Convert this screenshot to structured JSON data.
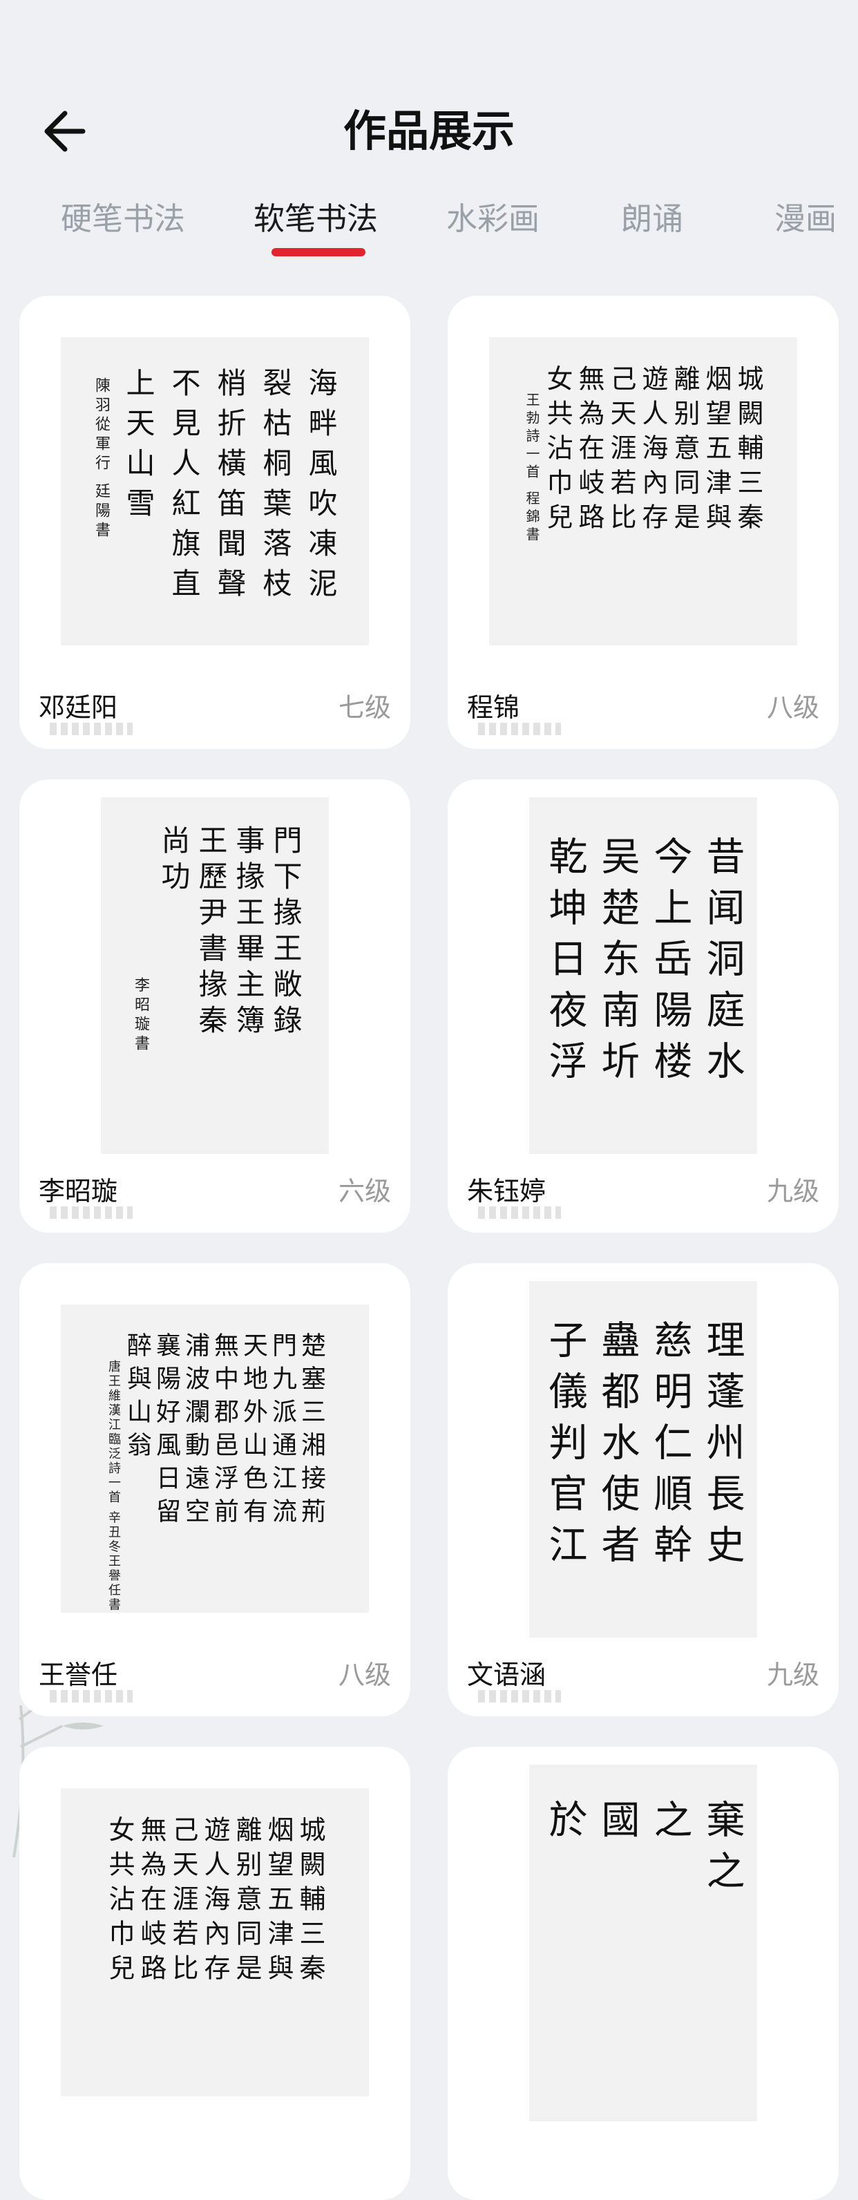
{
  "header": {
    "title": "作品展示"
  },
  "tabs": [
    "硬笔书法",
    "软笔书法",
    "水彩画",
    "朗诵",
    "漫画"
  ],
  "active_tab": "软笔书法",
  "colors": {
    "accent": "#e3232d",
    "background": "#eef0f3",
    "card": "#ffffff"
  },
  "icons": {
    "back": "arrow-left-icon"
  },
  "works": [
    {
      "name": "邓廷阳",
      "level": "七级",
      "columns": [
        "海畔風吹凍泥",
        "裂枯桐葉落枝",
        "梢折橫笛聞聲",
        "不見人紅旗直",
        "上天山雪"
      ],
      "inscription": "陳羽從軍行  廷陽書"
    },
    {
      "name": "程锦",
      "level": "八级",
      "columns": [
        "城闕輔三秦",
        "烟望五津與",
        "離别意同是",
        "遊人海內存",
        "己天涯若比",
        "無為在岐路",
        "女共沾巾兒"
      ],
      "inscription": "王勃詩一首 程錦書"
    },
    {
      "name": "李昭璇",
      "level": "六级",
      "columns": [
        "門下掾王敞錄",
        "事掾王畢主簿",
        "王歷尹書掾秦",
        "尚功"
      ],
      "inscription": "李昭璇書"
    },
    {
      "name": "朱钰婷",
      "level": "九级",
      "columns": [
        "昔闻洞庭水",
        "今上岳陽楼",
        "吴楚东南圻",
        "乾坤日夜浮"
      ],
      "inscription": ""
    },
    {
      "name": "王誉任",
      "level": "八级",
      "columns": [
        "楚塞三湘接荊",
        "門九派通江流",
        "天地外山色有",
        "無中郡邑浮前",
        "浦波瀾動遠空",
        "襄陽好風日留",
        "醉與山翁"
      ],
      "inscription": "唐王維漢江臨泛詩一首 辛丑冬王譽任書"
    },
    {
      "name": "文语涵",
      "level": "九级",
      "columns": [
        "理蓬州長史",
        "慈明仁順幹",
        "蠱都水使者",
        "子儀判官江"
      ],
      "inscription": ""
    },
    {
      "name": "",
      "level": "",
      "columns": [
        "城闕輔三秦",
        "烟望五津與",
        "離别意同是",
        "遊人海內存",
        "己天涯若比",
        "無為在岐路",
        "女共沾巾兒"
      ],
      "inscription": ""
    },
    {
      "name": "",
      "level": "",
      "columns": [
        "棄之",
        "之",
        "國",
        "於"
      ],
      "inscription": ""
    }
  ]
}
